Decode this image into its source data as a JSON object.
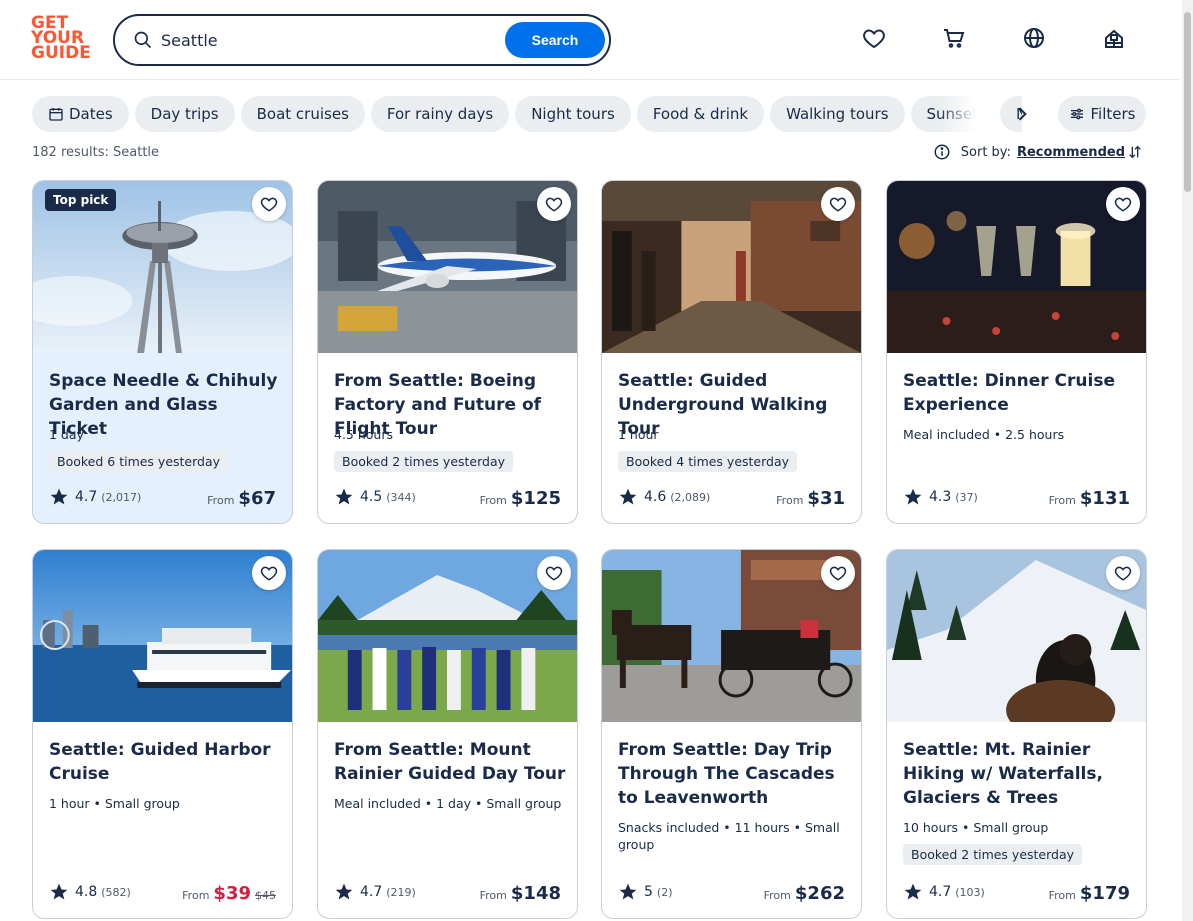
{
  "logo": {
    "lines": [
      "GET",
      "YOUR",
      "GUIDE"
    ]
  },
  "search": {
    "value": "Seattle",
    "button": "Search"
  },
  "header_icons": [
    "heart-icon",
    "cart-icon",
    "globe-icon",
    "profile-icon"
  ],
  "filters": {
    "chips": [
      "Dates",
      "Day trips",
      "Boat cruises",
      "For rainy days",
      "Night tours",
      "Food & drink",
      "Walking tours",
      "Sunset",
      "Nati"
    ],
    "filters_label": "Filters"
  },
  "results": {
    "summary": "182 results: Seattle",
    "sort_label": "Sort by:",
    "sort_value": "Recommended"
  },
  "cards": [
    {
      "title": "Space Needle & Chihuly Garden and Glass Ticket",
      "meta": "1 day",
      "booked": "Booked 6 times yesterday",
      "badge": "Top pick",
      "rating": "4.7",
      "count": "(2,017)",
      "from": "From",
      "price": "$67"
    },
    {
      "title": "From Seattle: Boeing Factory and Future of Flight Tour",
      "meta": "4.5 hours",
      "booked": "Booked 2 times yesterday",
      "rating": "4.5",
      "count": "(344)",
      "from": "From",
      "price": "$125"
    },
    {
      "title": "Seattle: Guided Underground Walking Tour",
      "meta": "1 hour",
      "booked": "Booked 4 times yesterday",
      "rating": "4.6",
      "count": "(2,089)",
      "from": "From",
      "price": "$31"
    },
    {
      "title": "Seattle: Dinner Cruise Experience",
      "meta": "Meal included • 2.5 hours",
      "rating": "4.3",
      "count": "(37)",
      "from": "From",
      "price": "$131"
    },
    {
      "title": "Seattle: Guided Harbor Cruise",
      "meta": "1 hour • Small group",
      "rating": "4.8",
      "count": "(582)",
      "from": "From",
      "price": "$39",
      "old_price": "$45"
    },
    {
      "title": "From Seattle: Mount Rainier Guided Day Tour",
      "meta": "Meal included • 1 day • Small group",
      "rating": "4.7",
      "count": "(219)",
      "from": "From",
      "price": "$148"
    },
    {
      "title": "From Seattle: Day Trip Through The Cascades to Leavenworth",
      "meta": "Snacks included • 11 hours • Small group",
      "rating": "5",
      "count": "(2)",
      "from": "From",
      "price": "$262"
    },
    {
      "title": "Seattle: Mt. Rainier Hiking w/ Waterfalls, Glaciers & Trees",
      "meta": "10 hours • Small group",
      "booked": "Booked 2 times yesterday",
      "rating": "4.7",
      "count": "(103)",
      "from": "From",
      "price": "$179"
    }
  ]
}
